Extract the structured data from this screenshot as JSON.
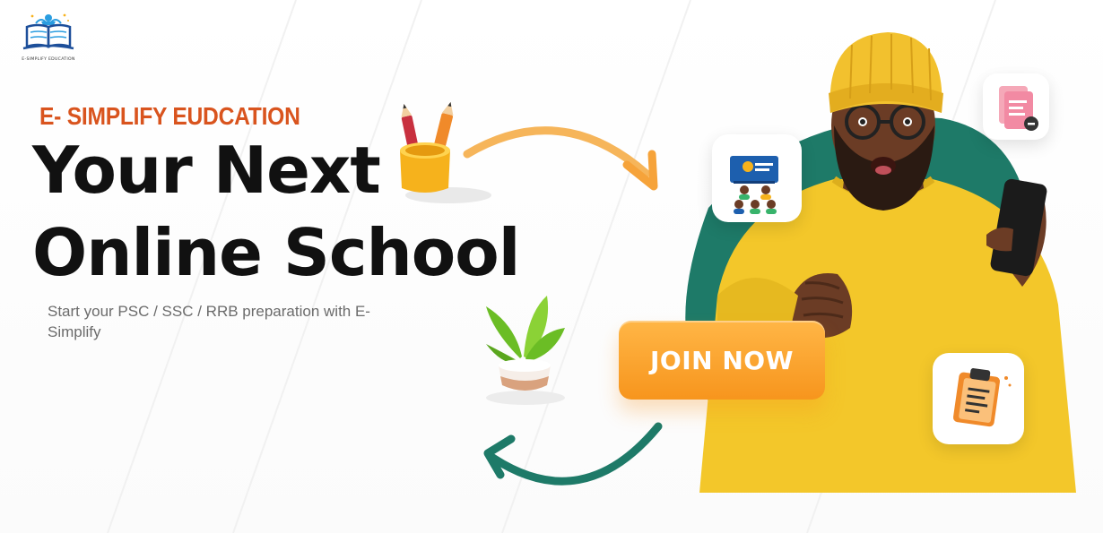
{
  "brand": {
    "logo_text": "E-SIMPLIFY EDUCATION"
  },
  "hero": {
    "kicker": "E- SIMPLIFY EUDCATION",
    "headline_line1": "Your Next",
    "headline_line2": "Online School",
    "subtitle": "Start your PSC / SSC / RRB preparation with E-Simplify"
  },
  "cta": {
    "join_label": "JOIN NOW"
  },
  "icons": {
    "logo": "book-graduate-logo-icon",
    "pencils": "pencil-cup-icon",
    "plant": "potted-plant-icon",
    "arrow_top": "curved-arrow-right-icon",
    "arrow_bottom": "curved-arrow-left-icon",
    "card1": "online-classroom-icon",
    "card2": "document-icon",
    "card3": "clipboard-icon"
  },
  "colors": {
    "accent_orange": "#f7951d",
    "kicker_red": "#d9541e",
    "teal": "#1e7a68",
    "shirt_yellow": "#f3c72a",
    "text_dark": "#111111"
  }
}
